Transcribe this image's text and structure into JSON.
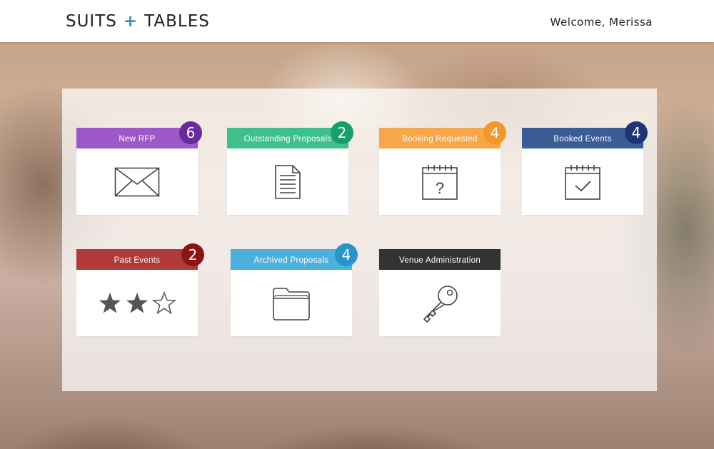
{
  "header": {
    "logo_left": "SUITS",
    "logo_plus": "+",
    "logo_right": "TABLES",
    "welcome": "Welcome, Merissa"
  },
  "tiles": [
    {
      "label": "New RFP",
      "count": "6",
      "color": "#9e57c8",
      "badge_color": "#6a2a9a",
      "icon": "envelope-icon"
    },
    {
      "label": "Outstanding Proposals",
      "count": "2",
      "color": "#3fbf8c",
      "badge_color": "#15a06a",
      "icon": "document-icon"
    },
    {
      "label": "Booking Requested",
      "count": "4",
      "color": "#f6a74a",
      "badge_color": "#f4962a",
      "icon": "calendar-question-icon"
    },
    {
      "label": "Booked Events",
      "count": "4",
      "color": "#3a5d95",
      "badge_color": "#1f3470",
      "icon": "calendar-check-icon"
    },
    {
      "label": "Past Events",
      "count": "2",
      "color": "#b03a3a",
      "badge_color": "#8c1414",
      "icon": "star-rating-icon"
    },
    {
      "label": "Archived Proposals",
      "count": "4",
      "color": "#4cb0dc",
      "badge_color": "#2595cb",
      "icon": "folder-icon"
    },
    {
      "label": "Venue Administration",
      "count": "",
      "color": "#333333",
      "badge_color": "",
      "icon": "key-icon"
    }
  ],
  "past_events_rating": {
    "filled": 2,
    "total": 3
  }
}
